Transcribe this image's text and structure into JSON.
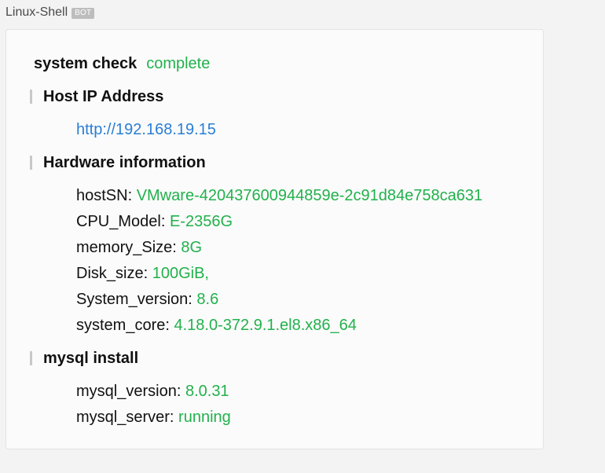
{
  "sender": {
    "name": "Linux-Shell",
    "badge": "BOT"
  },
  "message": {
    "title": "system check",
    "title_status": "complete",
    "sections": [
      {
        "heading": "Host IP Address",
        "link": "http://192.168.19.15"
      },
      {
        "heading": "Hardware information",
        "rows": [
          {
            "key": "hostSN",
            "value": "VMware-420437600944859e-2c91d84e758ca631"
          },
          {
            "key": "CPU_Model",
            "value": "E-2356G"
          },
          {
            "key": "memory_Size",
            "value": "8G"
          },
          {
            "key": "Disk_size",
            "value": "100GiB,"
          },
          {
            "key": "System_version",
            "value": "8.6"
          },
          {
            "key": "system_core",
            "value": "4.18.0-372.9.1.el8.x86_64"
          }
        ]
      },
      {
        "heading": "mysql install",
        "rows": [
          {
            "key": "mysql_version",
            "value": "8.0.31"
          },
          {
            "key": "mysql_server",
            "value": "running"
          }
        ]
      }
    ]
  },
  "colors": {
    "status_green": "#22b14c",
    "link_blue": "#2a7ed4",
    "section_bar": "#c8c8c8",
    "badge_bg": "#bdbdbd"
  }
}
